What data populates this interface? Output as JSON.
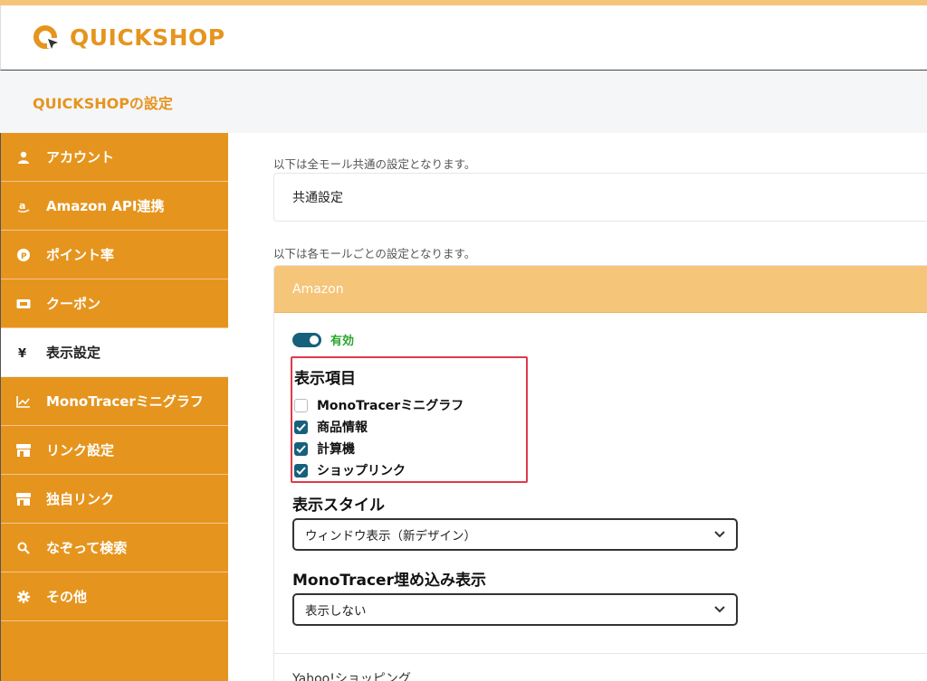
{
  "app": {
    "name": "QUICKSHOP",
    "brand_color": "#e5951e"
  },
  "subheader": {
    "title": "QUICKSHOPの設定"
  },
  "sidebar": {
    "items": [
      {
        "label": "アカウント",
        "icon": "user-icon",
        "active": false
      },
      {
        "label": "Amazon API連携",
        "icon": "amazon-icon",
        "active": false
      },
      {
        "label": "ポイント率",
        "icon": "point-icon",
        "active": false
      },
      {
        "label": "クーポン",
        "icon": "ticket-icon",
        "active": false
      },
      {
        "label": "表示設定",
        "icon": "yen-icon",
        "active": true
      },
      {
        "label": "MonoTracerミニグラフ",
        "icon": "chart-icon",
        "active": false
      },
      {
        "label": "リンク設定",
        "icon": "store-icon",
        "active": false
      },
      {
        "label": "独自リンク",
        "icon": "store-icon",
        "active": false
      },
      {
        "label": "なぞって検索",
        "icon": "search-icon",
        "active": false
      },
      {
        "label": "その他",
        "icon": "gear-icon",
        "active": false
      }
    ]
  },
  "main": {
    "common_note": "以下は全モール共通の設定となります。",
    "common_box_label": "共通設定",
    "mall_note": "以下は各モールごとの設定となります。",
    "card": {
      "title": "Amazon",
      "toggle": {
        "state": "on",
        "label": "有効"
      },
      "display_items": {
        "title": "表示項目",
        "options": [
          {
            "label": "MonoTracerミニグラフ",
            "checked": false
          },
          {
            "label": "商品情報",
            "checked": true
          },
          {
            "label": "計算機",
            "checked": true
          },
          {
            "label": "ショップリンク",
            "checked": true
          }
        ]
      },
      "display_style": {
        "title": "表示スタイル",
        "selected": "ウィンドウ表示（新デザイン）"
      },
      "monotracer_embed": {
        "title": "MonoTracer埋め込み表示",
        "selected": "表示しない"
      }
    },
    "next_card_title": "Yahoo!ショッピング"
  }
}
